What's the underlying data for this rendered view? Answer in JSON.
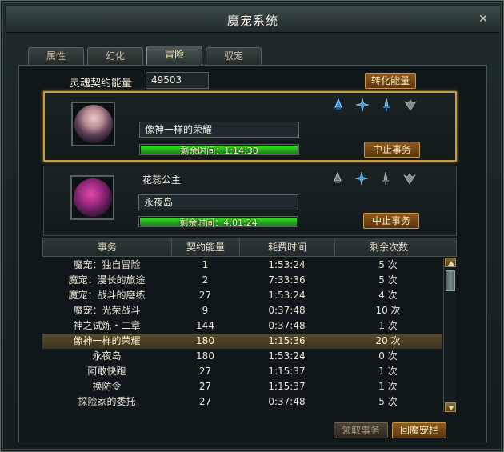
{
  "window": {
    "title": "魔宠系统",
    "close_icon": "close-icon"
  },
  "tabs": [
    {
      "label": "属性",
      "active": false
    },
    {
      "label": "幻化",
      "active": false
    },
    {
      "label": "冒险",
      "active": true
    },
    {
      "label": "驭宠",
      "active": false
    }
  ],
  "energy": {
    "label": "灵魂契约能量",
    "value": "49503",
    "convert_label": "转化能量"
  },
  "pets": [
    {
      "name": "",
      "mission": "像神一样的荣耀",
      "remaining_text": "剩余时间：1:14:30",
      "progress": 1.0,
      "stop_label": "中止事务",
      "selected": true,
      "element_icons": [
        "fire-bell-icon",
        "cross-star-icon",
        "sword-icon",
        "wing-icon"
      ]
    },
    {
      "name": "花蕊公主",
      "mission": "永夜岛",
      "remaining_text": "剩余时间：4:01:24",
      "progress": 1.0,
      "stop_label": "中止事务",
      "selected": false,
      "element_icons": [
        "bell-icon",
        "cross-star-icon",
        "sword-icon",
        "wing-icon"
      ]
    }
  ],
  "table": {
    "headers": [
      "事务",
      "契约能量",
      "耗费时间",
      "剩余次数"
    ],
    "rows": [
      [
        "魔宠：独自冒险",
        "1",
        "1:53:24",
        "5 次"
      ],
      [
        "魔宠：漫长的旅途",
        "2",
        "7:33:36",
        "5 次"
      ],
      [
        "魔宠：战斗的磨练",
        "27",
        "1:53:24",
        "4 次"
      ],
      [
        "魔宠：光荣战斗",
        "9",
        "0:37:48",
        "10 次"
      ],
      [
        "神之试炼・二章",
        "144",
        "0:37:48",
        "1 次"
      ],
      [
        "像神一样的荣耀",
        "180",
        "1:15:36",
        "20 次"
      ],
      [
        "永夜岛",
        "180",
        "1:53:24",
        "0 次"
      ],
      [
        "阿敢快跑",
        "27",
        "1:15:37",
        "1 次"
      ],
      [
        "换防令",
        "27",
        "1:15:37",
        "1 次"
      ],
      [
        "探险家的委托",
        "27",
        "0:37:48",
        "5 次"
      ]
    ],
    "selected_row": 5
  },
  "buttons": {
    "claim_label": "领取事务",
    "return_label": "回魔宠栏"
  }
}
